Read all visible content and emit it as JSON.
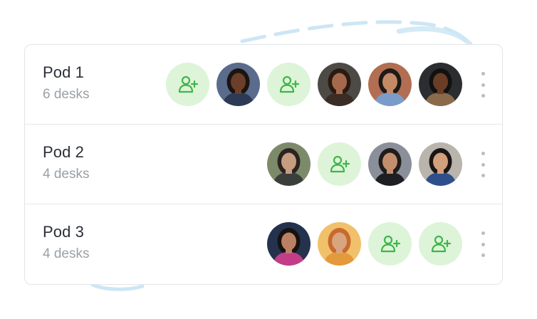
{
  "pods": [
    {
      "name": "Pod 1",
      "desks": "6 desks",
      "seats": [
        {
          "type": "empty",
          "icon": "add-user-icon"
        },
        {
          "type": "avatar",
          "skin": "#6b3f2a",
          "hair": "#1c1410",
          "bg": "#5a6b8c",
          "shirt": "#2c3a55"
        },
        {
          "type": "empty",
          "icon": "add-user-icon"
        },
        {
          "type": "avatar",
          "skin": "#a56a4b",
          "hair": "#2a1a12",
          "bg": "#4d4a46",
          "shirt": "#3b2c24"
        },
        {
          "type": "avatar",
          "skin": "#c48a66",
          "hair": "#1e1a18",
          "bg": "#b26e52",
          "shirt": "#7b9cc8"
        },
        {
          "type": "avatar",
          "skin": "#6a3d27",
          "hair": "#111111",
          "bg": "#2b2d31",
          "shirt": "#8a6a4a"
        }
      ]
    },
    {
      "name": "Pod 2",
      "desks": "4 desks",
      "seats": [
        {
          "type": "avatar",
          "skin": "#c79d82",
          "hair": "#2a2420",
          "bg": "#7d8a6a",
          "shirt": "#3a3f3c"
        },
        {
          "type": "empty",
          "icon": "add-user-icon"
        },
        {
          "type": "avatar",
          "skin": "#c28e6e",
          "hair": "#1f1c1a",
          "bg": "#8a8f99",
          "shirt": "#1e1f22"
        },
        {
          "type": "avatar",
          "skin": "#d1a07c",
          "hair": "#1a1614",
          "bg": "#b9b4ac",
          "shirt": "#2f4f8a"
        }
      ]
    },
    {
      "name": "Pod 3",
      "desks": "4 desks",
      "seats": [
        {
          "type": "avatar",
          "skin": "#b98063",
          "hair": "#16120f",
          "bg": "#24324e",
          "shirt": "#c23c88"
        },
        {
          "type": "avatar",
          "skin": "#d8a57e",
          "hair": "#c86a2e",
          "bg": "#f1c06a",
          "shirt": "#e39a3a"
        },
        {
          "type": "empty",
          "icon": "add-user-icon"
        },
        {
          "type": "empty",
          "icon": "add-user-icon"
        }
      ]
    }
  ],
  "colors": {
    "empty_seat_bg": "#ddf4d8",
    "add_icon": "#3fb54a",
    "more_dots": "#b9bdc4",
    "deco_blue": "#cde6f5"
  }
}
